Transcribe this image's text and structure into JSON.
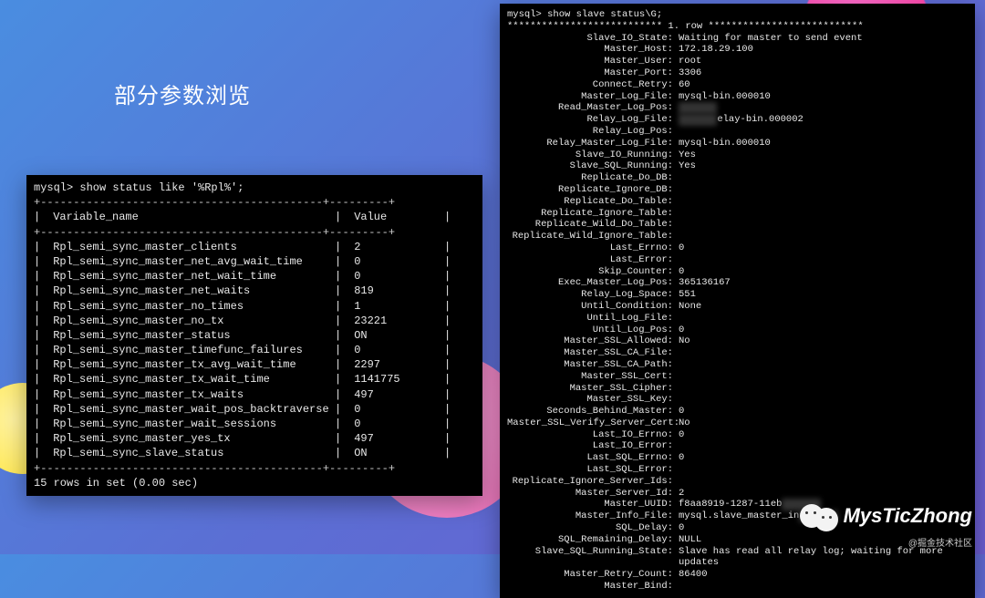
{
  "title": "部分参数浏览",
  "left_terminal": {
    "prompt": "mysql> show status like '%Rpl%';",
    "header_name": "Variable_name",
    "header_value": "Value",
    "rows": [
      {
        "name": "Rpl_semi_sync_master_clients",
        "value": "2"
      },
      {
        "name": "Rpl_semi_sync_master_net_avg_wait_time",
        "value": "0"
      },
      {
        "name": "Rpl_semi_sync_master_net_wait_time",
        "value": "0"
      },
      {
        "name": "Rpl_semi_sync_master_net_waits",
        "value": "819"
      },
      {
        "name": "Rpl_semi_sync_master_no_times",
        "value": "1"
      },
      {
        "name": "Rpl_semi_sync_master_no_tx",
        "value": "23221"
      },
      {
        "name": "Rpl_semi_sync_master_status",
        "value": "ON"
      },
      {
        "name": "Rpl_semi_sync_master_timefunc_failures",
        "value": "0"
      },
      {
        "name": "Rpl_semi_sync_master_tx_avg_wait_time",
        "value": "2297"
      },
      {
        "name": "Rpl_semi_sync_master_tx_wait_time",
        "value": "1141775"
      },
      {
        "name": "Rpl_semi_sync_master_tx_waits",
        "value": "497"
      },
      {
        "name": "Rpl_semi_sync_master_wait_pos_backtraverse",
        "value": "0"
      },
      {
        "name": "Rpl_semi_sync_master_wait_sessions",
        "value": "0"
      },
      {
        "name": "Rpl_semi_sync_master_yes_tx",
        "value": "497"
      },
      {
        "name": "Rpl_semi_sync_slave_status",
        "value": "ON"
      }
    ],
    "footer": "15 rows in set (0.00 sec)"
  },
  "right_terminal": {
    "prompt": "mysql> show slave status\\G;",
    "row_marker": "*************************** 1. row ***************************",
    "entries": [
      {
        "k": "Slave_IO_State",
        "v": "Waiting for master to send event"
      },
      {
        "k": "Master_Host",
        "v": "172.18.29.100"
      },
      {
        "k": "Master_User",
        "v": "root"
      },
      {
        "k": "Master_Port",
        "v": "3306"
      },
      {
        "k": "Connect_Retry",
        "v": "60"
      },
      {
        "k": "Master_Log_File",
        "v": "mysql-bin.000010"
      },
      {
        "k": "Read_Master_Log_Pos",
        "v": "",
        "blur": true
      },
      {
        "k": "Relay_Log_File",
        "v": "elay-bin.000002",
        "blur": "prefix"
      },
      {
        "k": "Relay_Log_Pos",
        "v": ""
      },
      {
        "k": "Relay_Master_Log_File",
        "v": "mysql-bin.000010"
      },
      {
        "k": "Slave_IO_Running",
        "v": "Yes"
      },
      {
        "k": "Slave_SQL_Running",
        "v": "Yes"
      },
      {
        "k": "Replicate_Do_DB",
        "v": ""
      },
      {
        "k": "Replicate_Ignore_DB",
        "v": ""
      },
      {
        "k": "Replicate_Do_Table",
        "v": ""
      },
      {
        "k": "Replicate_Ignore_Table",
        "v": ""
      },
      {
        "k": "Replicate_Wild_Do_Table",
        "v": ""
      },
      {
        "k": "Replicate_Wild_Ignore_Table",
        "v": ""
      },
      {
        "k": "Last_Errno",
        "v": "0"
      },
      {
        "k": "Last_Error",
        "v": ""
      },
      {
        "k": "Skip_Counter",
        "v": "0"
      },
      {
        "k": "Exec_Master_Log_Pos",
        "v": "365136167"
      },
      {
        "k": "Relay_Log_Space",
        "v": "551"
      },
      {
        "k": "Until_Condition",
        "v": "None"
      },
      {
        "k": "Until_Log_File",
        "v": ""
      },
      {
        "k": "Until_Log_Pos",
        "v": "0"
      },
      {
        "k": "Master_SSL_Allowed",
        "v": "No"
      },
      {
        "k": "Master_SSL_CA_File",
        "v": ""
      },
      {
        "k": "Master_SSL_CA_Path",
        "v": ""
      },
      {
        "k": "Master_SSL_Cert",
        "v": ""
      },
      {
        "k": "Master_SSL_Cipher",
        "v": ""
      },
      {
        "k": "Master_SSL_Key",
        "v": ""
      },
      {
        "k": "Seconds_Behind_Master",
        "v": "0"
      },
      {
        "k": "Master_SSL_Verify_Server_Cert",
        "v": "No"
      },
      {
        "k": "Last_IO_Errno",
        "v": "0"
      },
      {
        "k": "Last_IO_Error",
        "v": ""
      },
      {
        "k": "Last_SQL_Errno",
        "v": "0"
      },
      {
        "k": "Last_SQL_Error",
        "v": ""
      },
      {
        "k": "Replicate_Ignore_Server_Ids",
        "v": ""
      },
      {
        "k": "Master_Server_Id",
        "v": "2"
      },
      {
        "k": "Master_UUID",
        "v": "f8aa8919-1287-11eb",
        "blur": "suffix"
      },
      {
        "k": "Master_Info_File",
        "v": "mysql.slave_master_in",
        "blur": "suffix"
      },
      {
        "k": "SQL_Delay",
        "v": "0"
      },
      {
        "k": "SQL_Remaining_Delay",
        "v": "NULL"
      },
      {
        "k": "Slave_SQL_Running_State",
        "v": "Slave has read all relay log; waiting for more updates"
      },
      {
        "k": "Master_Retry_Count",
        "v": "86400"
      },
      {
        "k": "Master_Bind",
        "v": ""
      }
    ]
  },
  "watermark": {
    "name": "MysTicZhong",
    "sub": "@掘金技术社区"
  },
  "sep": "+-------------------------------------------+---------+"
}
